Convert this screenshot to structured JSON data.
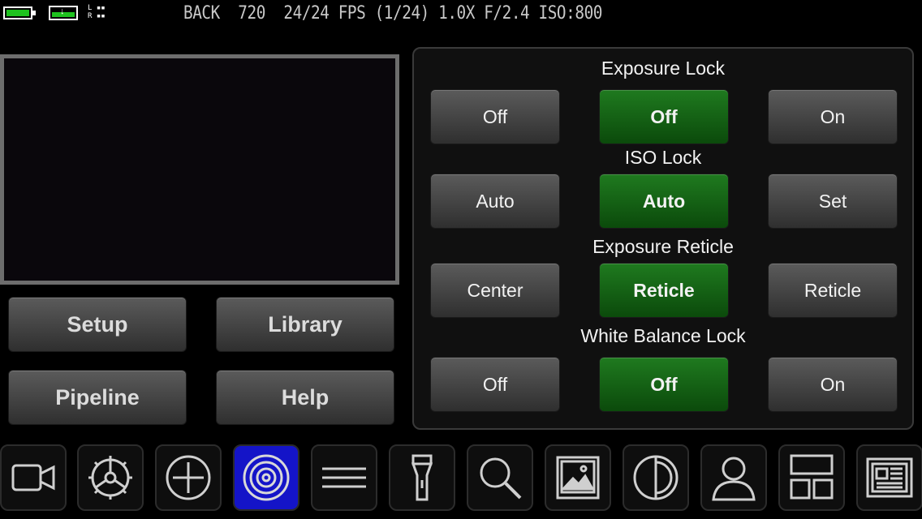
{
  "status_bar": {
    "lr_top": "L",
    "lr_bottom": "R",
    "camera": "BACK",
    "resolution": "720",
    "fps": "24/24 FPS",
    "shutter": "(1/24)",
    "zoom": "1.0X",
    "aperture": "F/2.4",
    "iso": "ISO:800",
    "battery_color": "#1ec21e"
  },
  "menu": {
    "setup": "Setup",
    "library": "Library",
    "pipeline": "Pipeline",
    "help": "Help"
  },
  "controls": [
    {
      "title": "Exposure Lock",
      "options": [
        "Off",
        "Off",
        "On"
      ],
      "selected_index": 1
    },
    {
      "title": "ISO Lock",
      "options": [
        "Auto",
        "Auto",
        "Set"
      ],
      "selected_index": 1
    },
    {
      "title": "Exposure Reticle",
      "options": [
        "Center",
        "Reticle",
        "Reticle"
      ],
      "selected_index": 1
    },
    {
      "title": "White Balance Lock",
      "options": [
        "Off",
        "Off",
        "On"
      ],
      "selected_index": 1
    }
  ],
  "toolbar": {
    "icons": [
      "video-camera-icon",
      "settings-dial-icon",
      "crosshair-plus-icon",
      "target-icon",
      "menu-lines-icon",
      "flashlight-icon",
      "magnifier-icon",
      "photo-icon",
      "contrast-icon",
      "user-icon",
      "layout-grid-icon",
      "newspaper-icon"
    ],
    "active": "target-icon",
    "active_color": "#1414c8"
  }
}
